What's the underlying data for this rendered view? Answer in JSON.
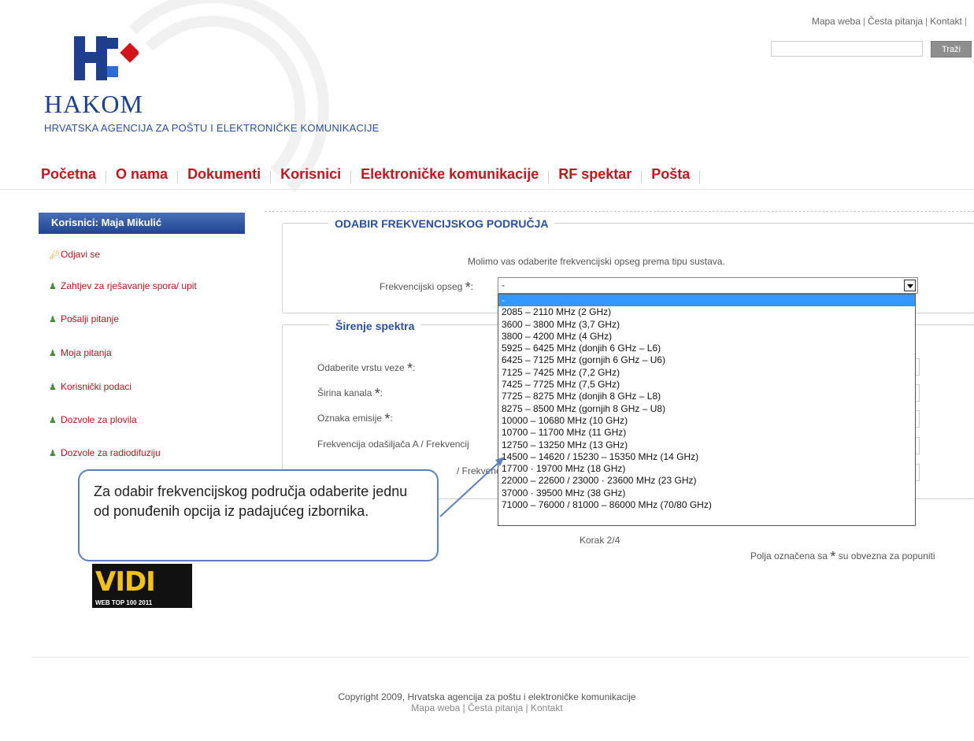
{
  "header": {
    "links": [
      "Mapa weba",
      "Česta pitanja",
      "Kontakt"
    ],
    "search": {
      "value": "",
      "button_label": "Traži"
    }
  },
  "logo": {
    "name": "HAKOM",
    "subtitle": "HRVATSKA AGENCIJA ZA POŠTU I ELEKTRONIČKE KOMUNIKACIJE"
  },
  "nav": {
    "items": [
      "Početna",
      "O nama",
      "Dokumenti",
      "Korisnici",
      "Elektroničke komunikacije",
      "RF spektar",
      "Pošta"
    ]
  },
  "sidebar": {
    "user_label": "Korisnici: Maja Mikulić",
    "items": [
      {
        "label": "Odjavi se",
        "icon": "key-icon"
      },
      {
        "label": "Zahtjev za rješavanje spora/ upit",
        "icon": "user-icon"
      },
      {
        "label": "Pošalji pitanje",
        "icon": "user-icon"
      },
      {
        "label": "Moja pitanja",
        "icon": "user-icon"
      },
      {
        "label": "Korisnički podaci",
        "icon": "user-icon"
      },
      {
        "label": "Dozvole za plovila",
        "icon": "user-icon"
      },
      {
        "label": "Dozvole za radiodifuziju",
        "icon": "user-icon"
      }
    ]
  },
  "section1": {
    "legend": "ODABIR FREKVENCIJSKOG PODRUČJA",
    "instruction": "Molimo vas odaberite frekvencijski opseg prema tipu sustava.",
    "field_label": "Frekvencijski opseg",
    "required_mark": "*",
    "selected_value": "-"
  },
  "dropdown": {
    "options": [
      "-",
      "2085 – 2110 MHz (2 GHz)",
      "3600 – 3800 MHz (3,7 GHz)",
      "3800 – 4200 MHz (4 GHz)",
      "5925 – 6425 MHz (donjih 6 GHz – L6)",
      "6425 – 7125 MHz (gornjih 6 GHz – U6)",
      "7125 – 7425 MHz (7,2 GHz)",
      "7425 – 7725 MHz (7,5 GHz)",
      "7725 – 8275 MHz (donjih 8 GHz – L8)",
      "8275 – 8500 MHz (gornjih 8 GHz – U8)",
      "10000 – 10680 MHz (10 GHz)",
      "10700 – 11700 MHz (11 GHz)",
      "12750 – 13250 MHz (13 GHz)",
      "14500 – 14620 / 15230 – 15350 MHz (14 GHz)",
      "17700 · 19700 MHz (18 GHz)",
      "22000 – 22600 / 23000 · 23600 MHz (23 GHz)",
      "37000 · 39500 MHz (38 GHz)",
      "71000 – 76000 / 81000 – 86000 MHz (70/80 GHz)"
    ],
    "highlighted": "-"
  },
  "section2": {
    "legend": "Širenje spektra",
    "labels": [
      "Odaberite vrstu veze",
      "Širina kanala",
      "Oznaka emisije",
      "Frekvencija odašiljača A / Frekvencij",
      "/ Frekvenc"
    ]
  },
  "callout": {
    "text": "Za odabir frekvencijskog područja odaberite jednu od ponuđenih opcija iz padajućeg izbornika."
  },
  "step": "Korak 2/4",
  "required_note": {
    "prefix": "Polja označena sa",
    "suffix": "su obvezna za popuniti"
  },
  "badge": {
    "title": "VIDI",
    "subtitle": "WEB TOP 100   2011"
  },
  "footer": {
    "copyright": "Copyright 2009, Hrvatska agencija za poštu i elektroničke komunikacije",
    "links": [
      "Mapa weba",
      "Česta pitanja",
      "Kontakt"
    ]
  },
  "colors": {
    "brand_blue": "#1e3f8c",
    "nav_red": "#c4161c",
    "highlight": "#3399ff"
  }
}
